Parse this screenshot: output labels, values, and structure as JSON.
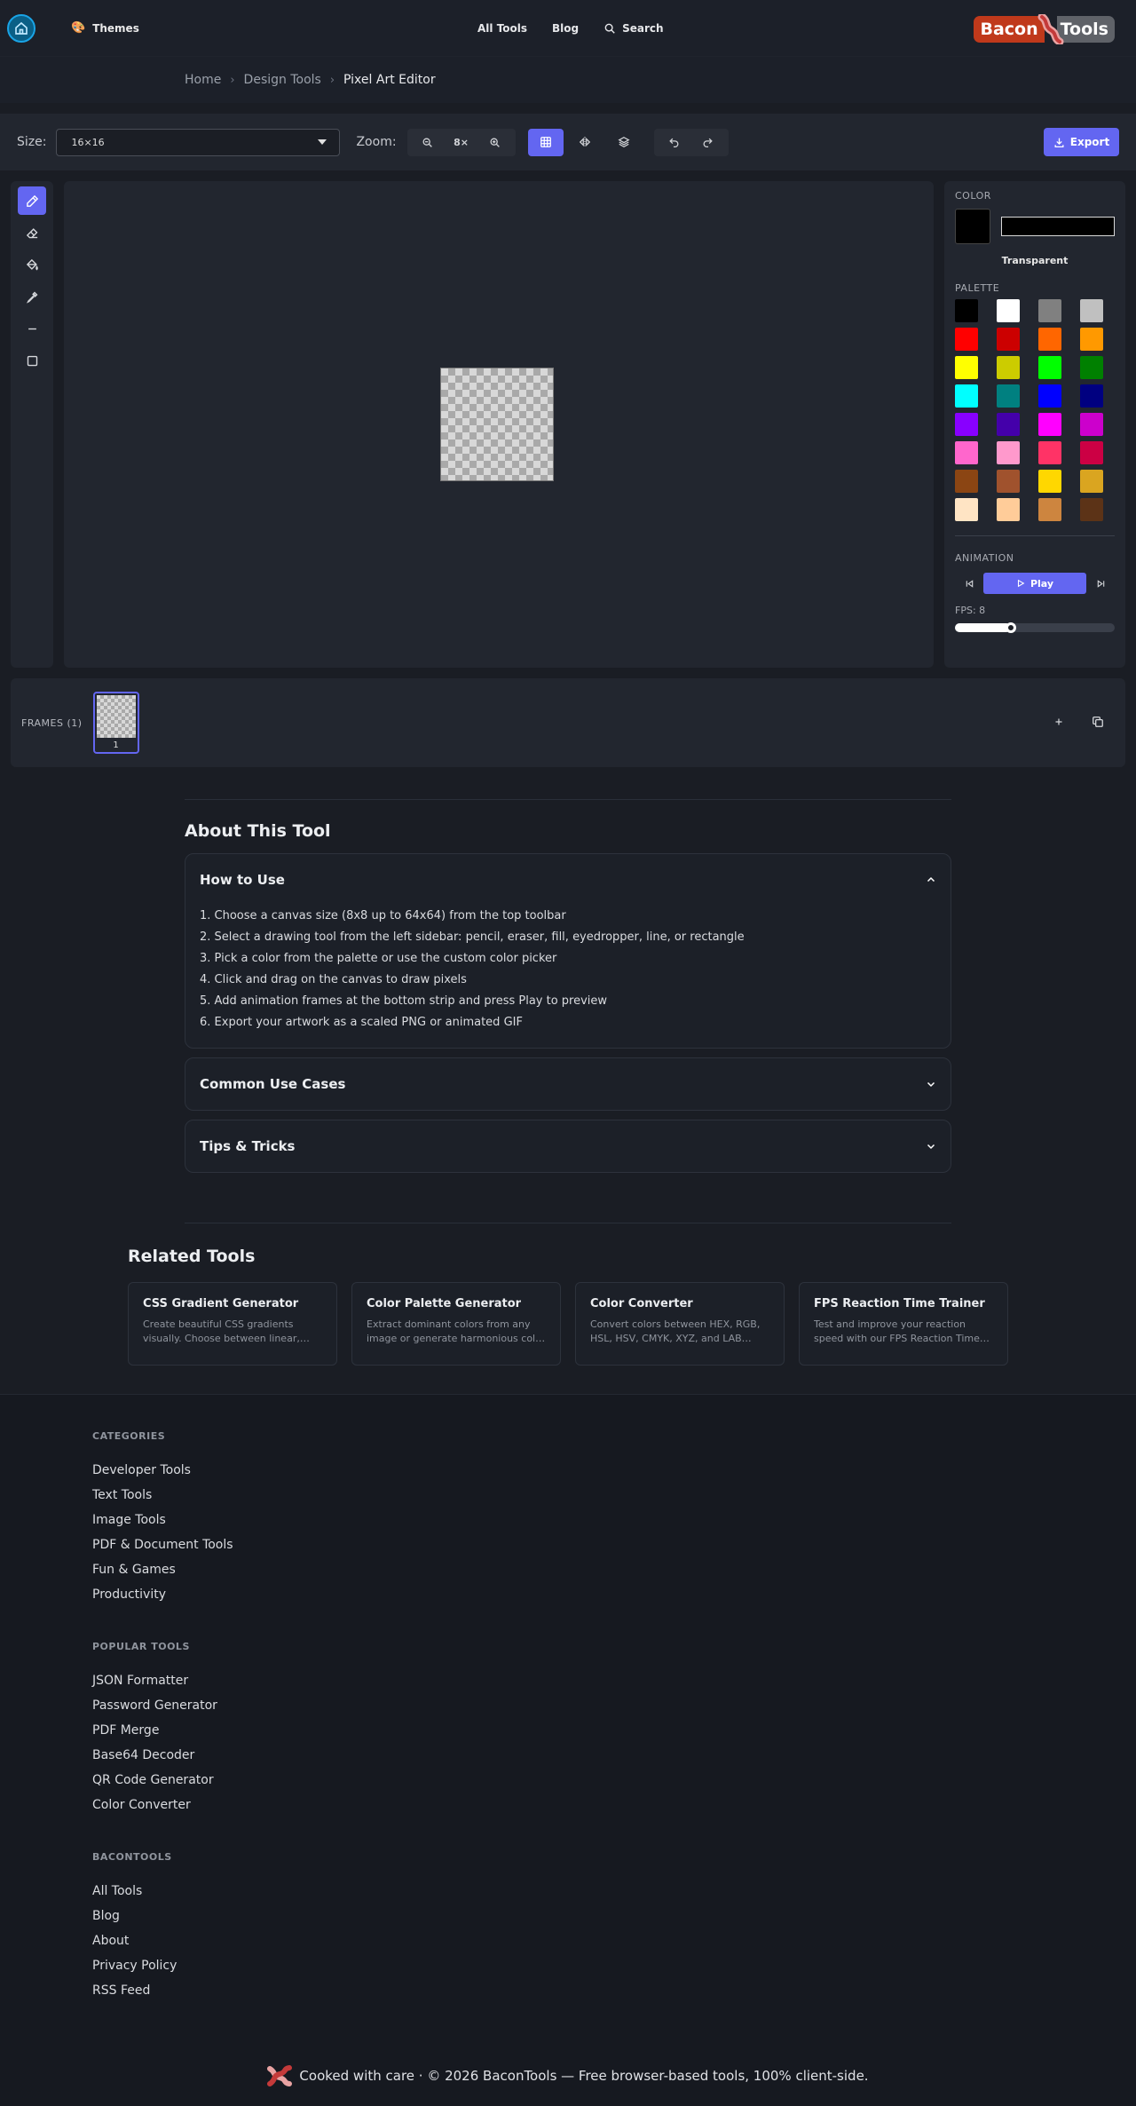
{
  "header": {
    "themes_label": "Themes",
    "nav": {
      "all_tools": "All Tools",
      "blog": "Blog",
      "search": "Search"
    },
    "logo": {
      "part1": "Bacon",
      "part2": "Tools"
    }
  },
  "breadcrumb": {
    "home": "Home",
    "category": "Design Tools",
    "current": "Pixel Art Editor"
  },
  "toolbar": {
    "size_label": "Size:",
    "size_value": "16×16",
    "zoom_label": "Zoom:",
    "zoom_value": "8×",
    "export_label": "Export"
  },
  "tools": [
    "pencil-icon",
    "eraser-icon",
    "fill-bucket-icon",
    "eyedropper-icon",
    "line-icon",
    "rectangle-icon"
  ],
  "side_panel": {
    "color_heading": "COLOR",
    "current_color": "#000000",
    "transparent_label": "Transparent",
    "palette_heading": "PALETTE",
    "palette": [
      "#000000",
      "#ffffff",
      "#808080",
      "#c0c0c0",
      "#ff0000",
      "#cc0000",
      "#ff6600",
      "#ff9900",
      "#ffff00",
      "#cccc00",
      "#00ff00",
      "#008000",
      "#00ffff",
      "#008080",
      "#0000ff",
      "#000080",
      "#8800ff",
      "#4400aa",
      "#ff00ff",
      "#cc00cc",
      "#ff66cc",
      "#ff99cc",
      "#ff3366",
      "#cc0044",
      "#8b4513",
      "#a0522d",
      "#ffd700",
      "#daa520",
      "#ffe4c4",
      "#ffcc99",
      "#cd853f",
      "#5c3317"
    ],
    "animation_heading": "ANIMATION",
    "play_label": "Play",
    "fps_label": "FPS: 8",
    "fps_value": 8,
    "fps_slider_fraction": 0.35
  },
  "frames": {
    "label": "FRAMES (1)",
    "items": [
      "1"
    ]
  },
  "about": {
    "title": "About This Tool",
    "how_to_use": {
      "title": "How to Use",
      "steps": [
        "1. Choose a canvas size (8x8 up to 64x64) from the top toolbar",
        "2. Select a drawing tool from the left sidebar: pencil, eraser, fill, eyedropper, line, or rectangle",
        "3. Pick a color from the palette or use the custom color picker",
        "4. Click and drag on the canvas to draw pixels",
        "5. Add animation frames at the bottom strip and press Play to preview",
        "6. Export your artwork as a scaled PNG or animated GIF"
      ]
    },
    "use_cases_title": "Common Use Cases",
    "tips_title": "Tips & Tricks"
  },
  "related": {
    "title": "Related Tools",
    "cards": [
      {
        "title": "CSS Gradient Generator",
        "desc": "Create beautiful CSS gradients visually. Choose between linear, radial, and conic gradients."
      },
      {
        "title": "Color Palette Generator",
        "desc": "Extract dominant colors from any image or generate harmonious color palettes."
      },
      {
        "title": "Color Converter",
        "desc": "Convert colors between HEX, RGB, HSL, HSV, CMYK, XYZ, and LAB formats."
      },
      {
        "title": "FPS Reaction Time Trainer",
        "desc": "Test and improve your reaction speed with our FPS Reaction Time Trainer."
      }
    ]
  },
  "footer": {
    "categories": {
      "heading": "CATEGORIES",
      "links": [
        "Developer Tools",
        "Text Tools",
        "Image Tools",
        "PDF & Document Tools",
        "Fun & Games",
        "Productivity"
      ]
    },
    "popular": {
      "heading": "POPULAR TOOLS",
      "links": [
        "JSON Formatter",
        "Password Generator",
        "PDF Merge",
        "Base64 Decoder",
        "QR Code Generator",
        "Color Converter"
      ]
    },
    "bacontools": {
      "heading": "BACONTOOLS",
      "links": [
        "All Tools",
        "Blog",
        "About",
        "Privacy Policy",
        "RSS Feed"
      ]
    },
    "copyright": "Cooked with care · © 2026 BaconTools — Free browser-based tools, 100% client-side."
  }
}
